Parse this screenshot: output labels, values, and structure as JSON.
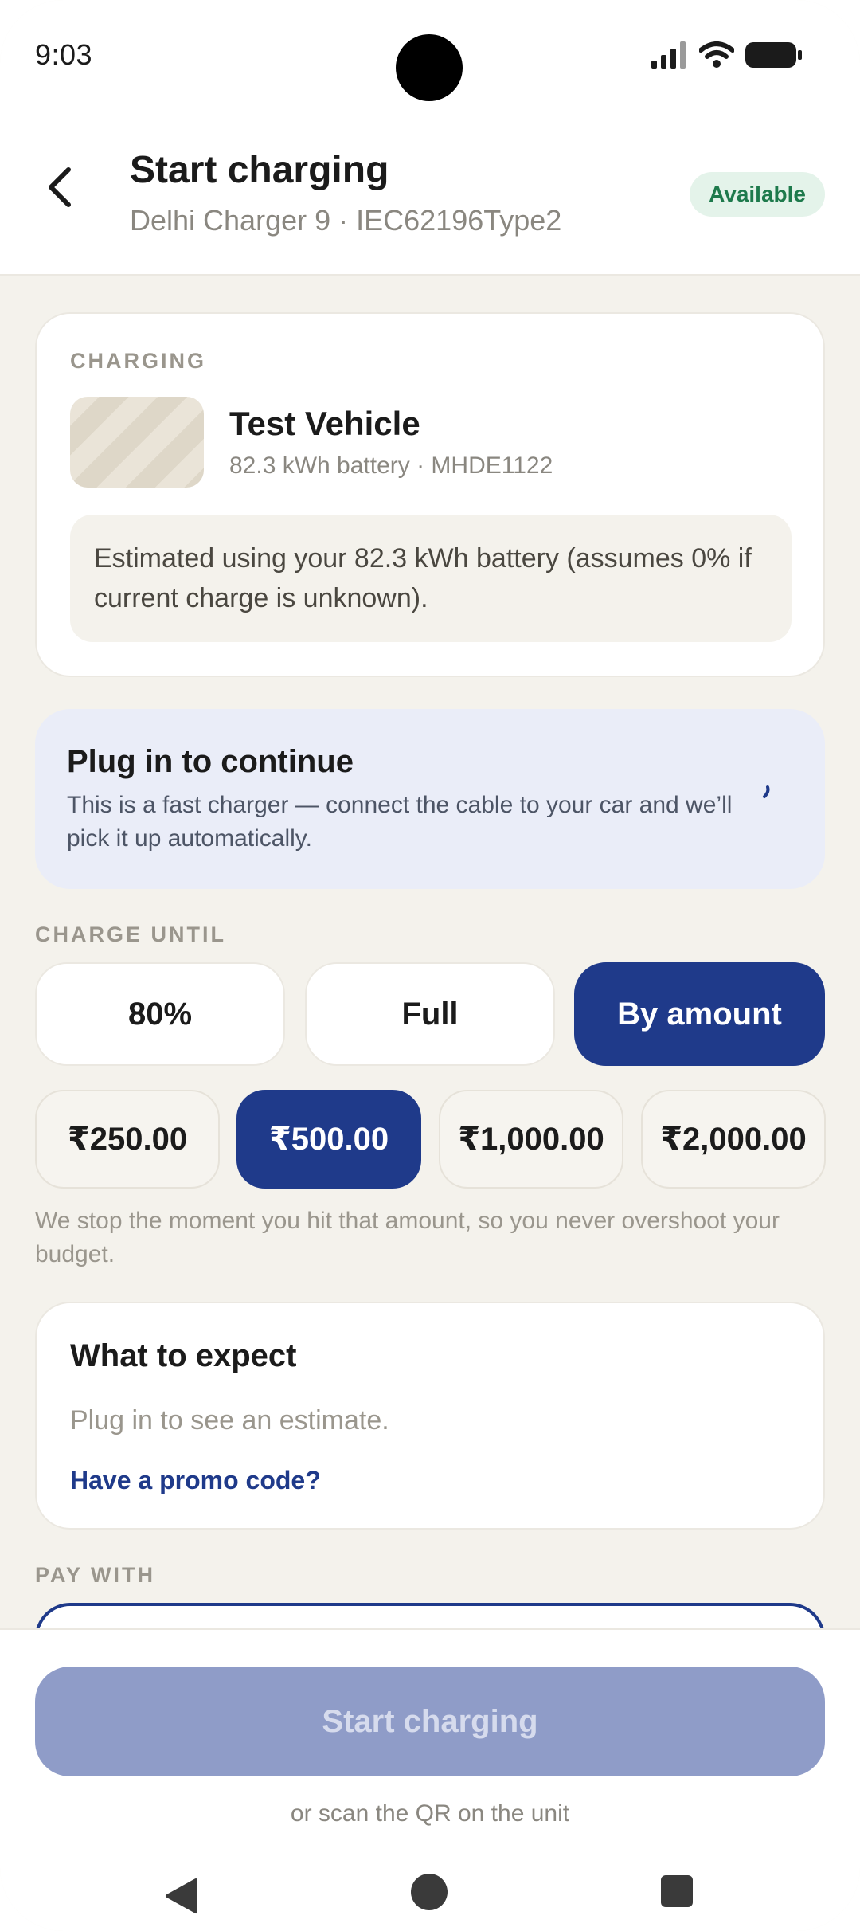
{
  "status_bar": {
    "time": "9:03"
  },
  "header": {
    "title": "Start charging",
    "subtitle": "Delhi Charger 9 · IEC62196Type2",
    "status_badge": "Available"
  },
  "vehicle_card": {
    "section_label": "CHARGING",
    "vehicle_name": "Test Vehicle",
    "vehicle_details": "82.3 kWh battery · MHDE1122",
    "estimate_note": "Estimated using your 82.3 kWh battery (assumes 0% if current charge is unknown)."
  },
  "plug_banner": {
    "title": "Plug in to continue",
    "text": "This is a fast charger — connect the cable to your car and we’ll pick it up automatically."
  },
  "charge_until": {
    "label": "CHARGE UNTIL",
    "options": [
      "80%",
      "Full",
      "By amount"
    ],
    "selected": "By amount",
    "amounts": [
      "₹250.00",
      "₹500.00",
      "₹1,000.00",
      "₹2,000.00"
    ],
    "selected_amount": "₹500.00",
    "help_text": "We stop the moment you hit that amount, so you never overshoot your budget."
  },
  "expect_card": {
    "title": "What to expect",
    "text": "Plug in to see an estimate.",
    "promo_link": "Have a promo code?"
  },
  "pay_with": {
    "label": "PAY WITH"
  },
  "footer": {
    "start_button": "Start charging",
    "qr_hint": "or scan the QR on the unit"
  },
  "colors": {
    "accent": "#1f3a8a",
    "background": "#f4f2ec",
    "available_green": "#1e7a4c",
    "disabled_button": "#8f9cc8"
  }
}
